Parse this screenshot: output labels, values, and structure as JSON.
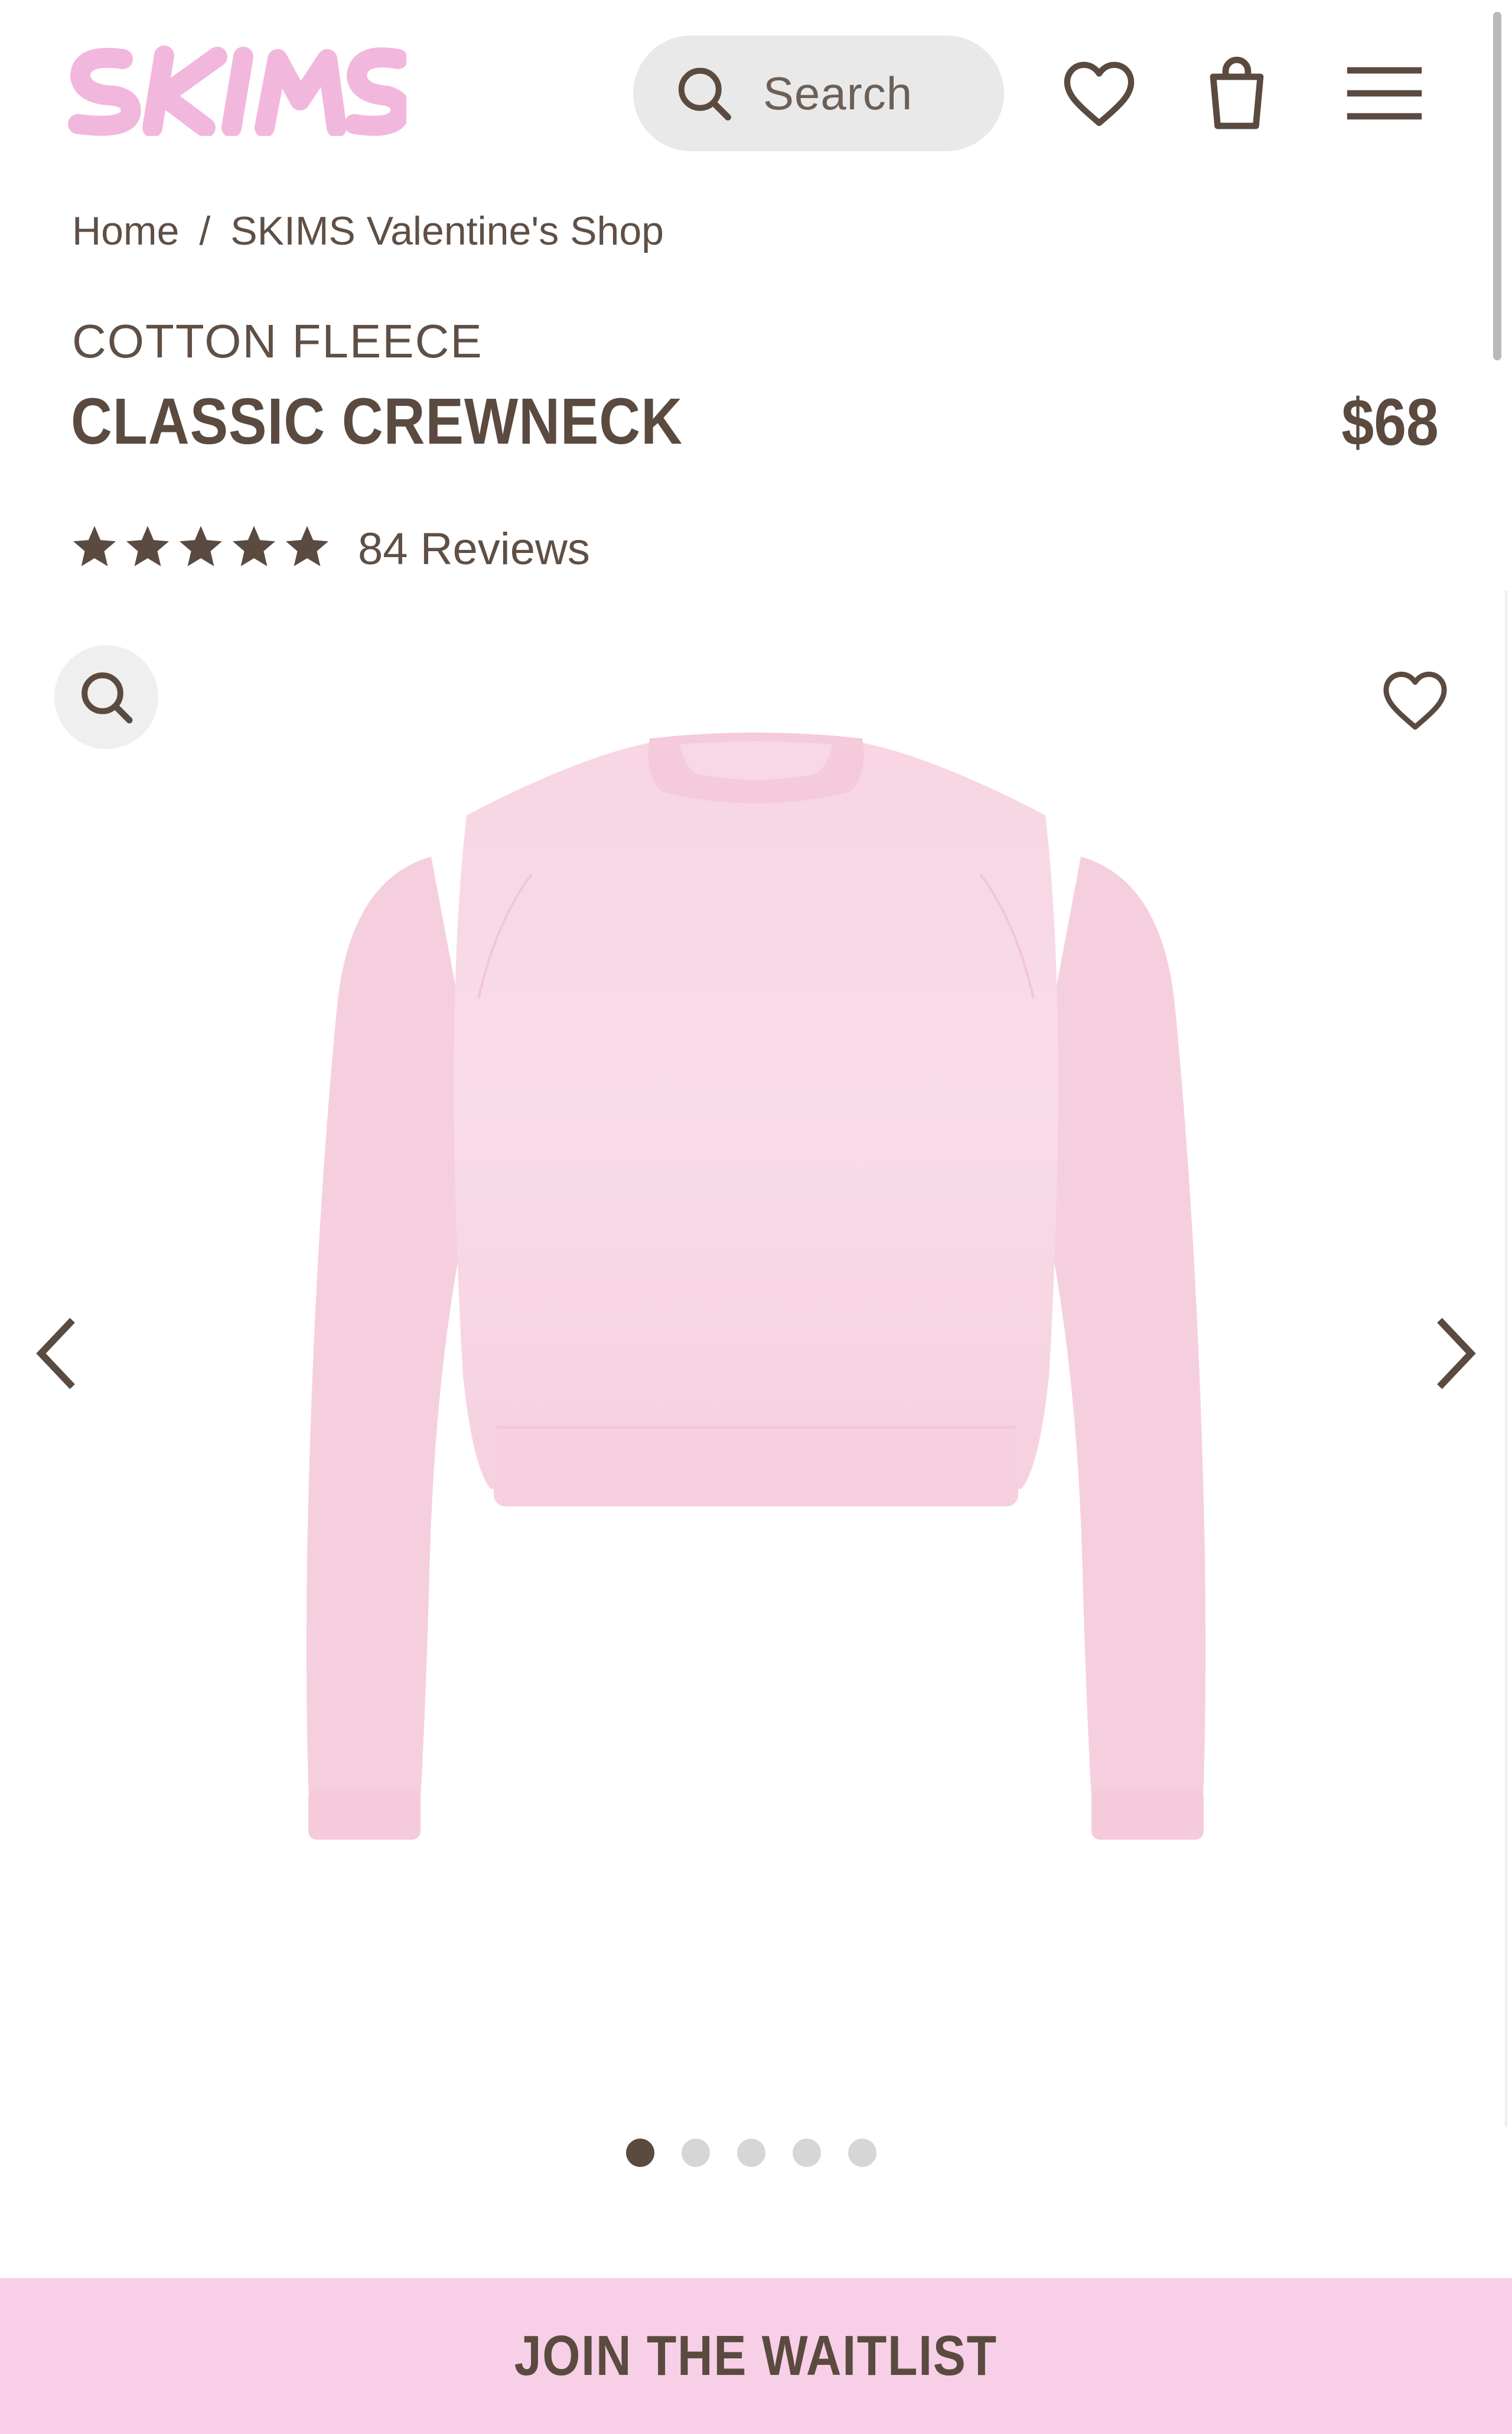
{
  "header": {
    "logo_text": "SKIMS",
    "search_placeholder": "Search",
    "icons": [
      "search-icon",
      "heart-icon",
      "shopping-bag-icon",
      "hamburger-menu-icon"
    ]
  },
  "breadcrumb": {
    "items": [
      "Home",
      "SKIMS Valentine's Shop"
    ],
    "separator": "/"
  },
  "product": {
    "category": "COTTON FLEECE",
    "title": "CLASSIC CREWNECK",
    "price": "$68",
    "rating": 5,
    "rating_max": 5,
    "reviews_label": "84 Reviews"
  },
  "gallery": {
    "current_index": 1,
    "total_images": 5,
    "icons": [
      "zoom-icon",
      "heart-icon",
      "chevron-left-icon",
      "chevron-right-icon"
    ]
  },
  "cta": {
    "label": "JOIN THE WAITLIST"
  },
  "colors": {
    "brand_pink": "#f7cfe6",
    "logo_pink": "#f2b7dc",
    "text_brown": "#5a4a3f",
    "product_pink": "#f7d3e2"
  }
}
